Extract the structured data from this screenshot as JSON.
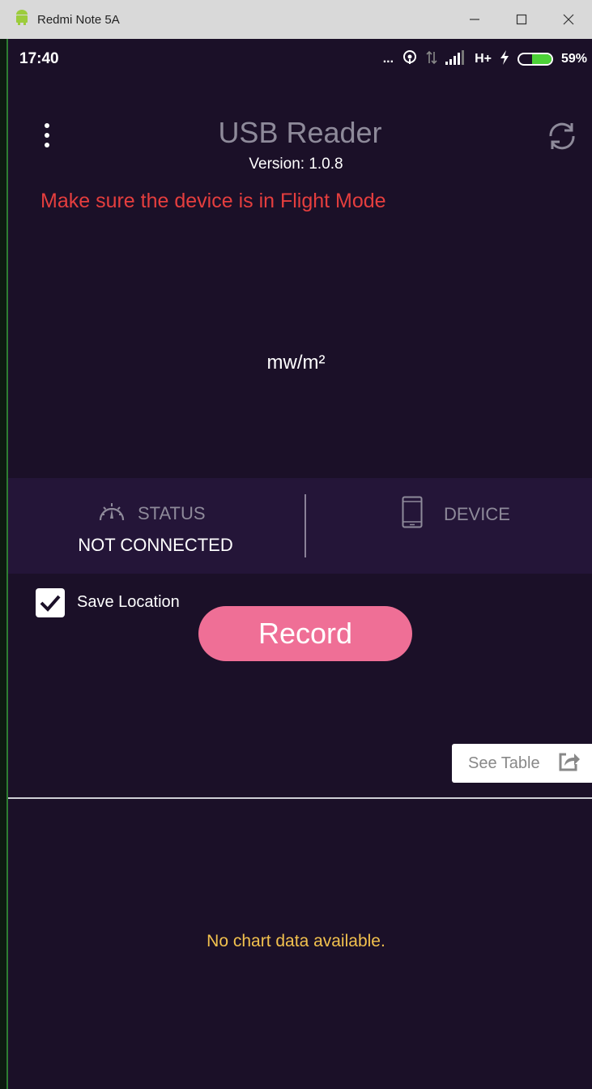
{
  "window": {
    "title": "Redmi Note 5A",
    "icon": "android-icon",
    "controls": [
      "minimize-icon",
      "maximize-icon",
      "close-icon"
    ]
  },
  "statusbar": {
    "time": "17:40",
    "more": "...",
    "network": "H+",
    "battery_level": "59%",
    "battery_fraction": 0.59
  },
  "header": {
    "menu_icon": "more-vertical-icon",
    "title": "USB Reader",
    "refresh_icon": "refresh-icon",
    "version": "Version: 1.0.8"
  },
  "warning": "Make sure the device is in Flight Mode",
  "reading": {
    "unit": "mw/m²"
  },
  "panel": {
    "status_label": "STATUS",
    "status_value": "NOT CONNECTED",
    "status_icon": "gauge-icon",
    "device_label": "DEVICE",
    "device_icon": "phone-icon"
  },
  "controls": {
    "save_location_label": "Save Location",
    "save_location_checked": true,
    "record_label": "Record",
    "see_table_label": "See Table",
    "see_table_icon": "share-icon"
  },
  "chart": {
    "empty_message": "No chart data available."
  },
  "colors": {
    "background": "#1b1028",
    "panel": "#241538",
    "warning": "#e53e3e",
    "record": "#ef6f96",
    "empty_message": "#f2c14e"
  }
}
